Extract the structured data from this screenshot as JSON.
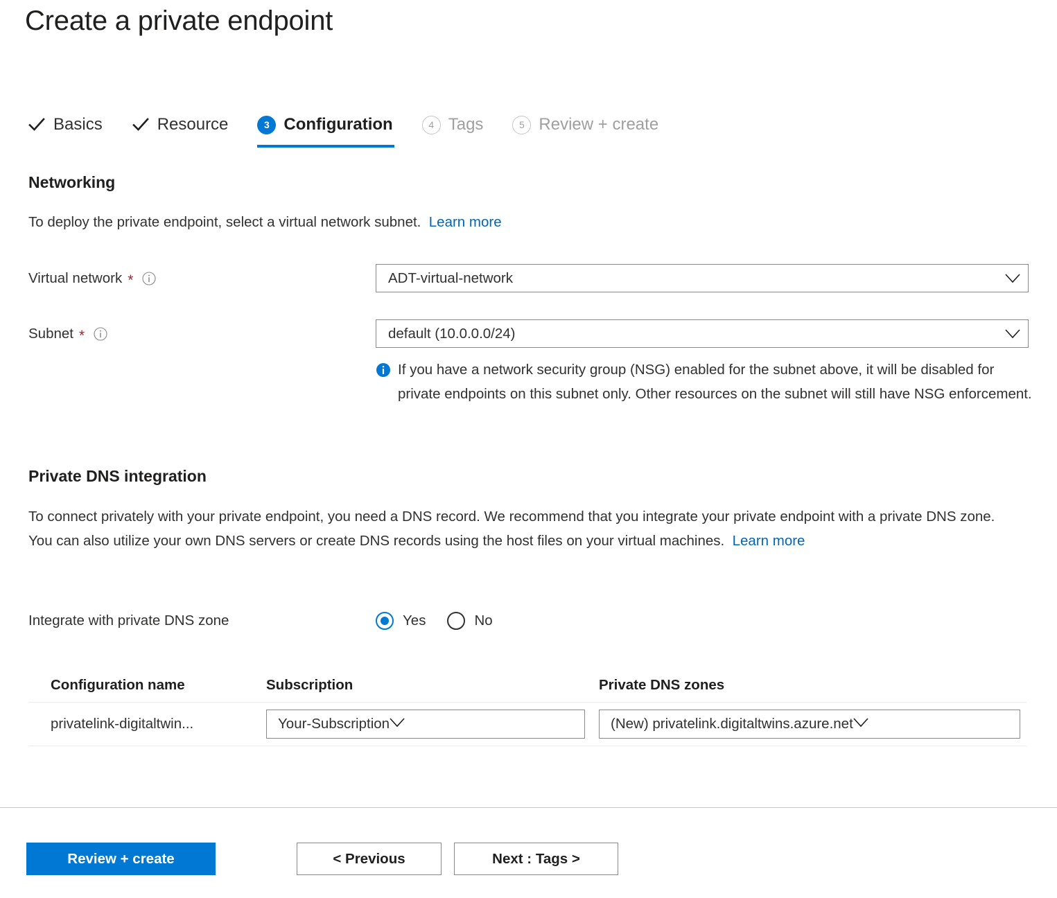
{
  "page": {
    "title": "Create a private endpoint"
  },
  "wizard": {
    "tabs": [
      {
        "label": "Basics",
        "state": "done",
        "marker": "check"
      },
      {
        "label": "Resource",
        "state": "done",
        "marker": "check"
      },
      {
        "label": "Configuration",
        "state": "active",
        "marker": "3"
      },
      {
        "label": "Tags",
        "state": "pending",
        "marker": "4"
      },
      {
        "label": "Review + create",
        "state": "pending",
        "marker": "5"
      }
    ]
  },
  "networking": {
    "heading": "Networking",
    "description": "To deploy the private endpoint, select a virtual network subnet.",
    "learn_more": "Learn more",
    "virtual_network": {
      "label": "Virtual network",
      "required_marker": "*",
      "value": "ADT-virtual-network"
    },
    "subnet": {
      "label": "Subnet",
      "required_marker": "*",
      "value": "default (10.0.0.0/24)"
    },
    "nsg_info": "If you have a network security group (NSG) enabled for the subnet above, it will be disabled for private endpoints on this subnet only. Other resources on the subnet will still have NSG enforcement."
  },
  "private_dns": {
    "heading": "Private DNS integration",
    "description": "To connect privately with your private endpoint, you need a DNS record. We recommend that you integrate your private endpoint with a private DNS zone. You can also utilize your own DNS servers or create DNS records using the host files on your virtual machines.",
    "learn_more": "Learn more",
    "integrate": {
      "prompt": "Integrate with private DNS zone",
      "options": [
        {
          "label": "Yes",
          "selected": true
        },
        {
          "label": "No",
          "selected": false
        }
      ]
    },
    "table": {
      "headers": {
        "configuration_name": "Configuration name",
        "subscription": "Subscription",
        "private_dns_zones": "Private DNS zones"
      },
      "rows": [
        {
          "configuration_name": "privatelink-digitaltwin...",
          "subscription": "Your-Subscription",
          "private_dns_zone": "(New) privatelink.digitaltwins.azure.net"
        }
      ]
    }
  },
  "footer": {
    "review_create": "Review + create",
    "previous": "< Previous",
    "next": "Next : Tags >"
  },
  "colors": {
    "accent_blue": "#0078d4",
    "link_blue": "#0067b8",
    "required_red": "#a4262c",
    "text_primary": "#201f1e",
    "text_secondary": "#323130",
    "text_disabled": "#a19f9d",
    "border_grey": "#8a8886",
    "divider_grey": "#c8c6c4",
    "row_divider": "#edebe9"
  }
}
